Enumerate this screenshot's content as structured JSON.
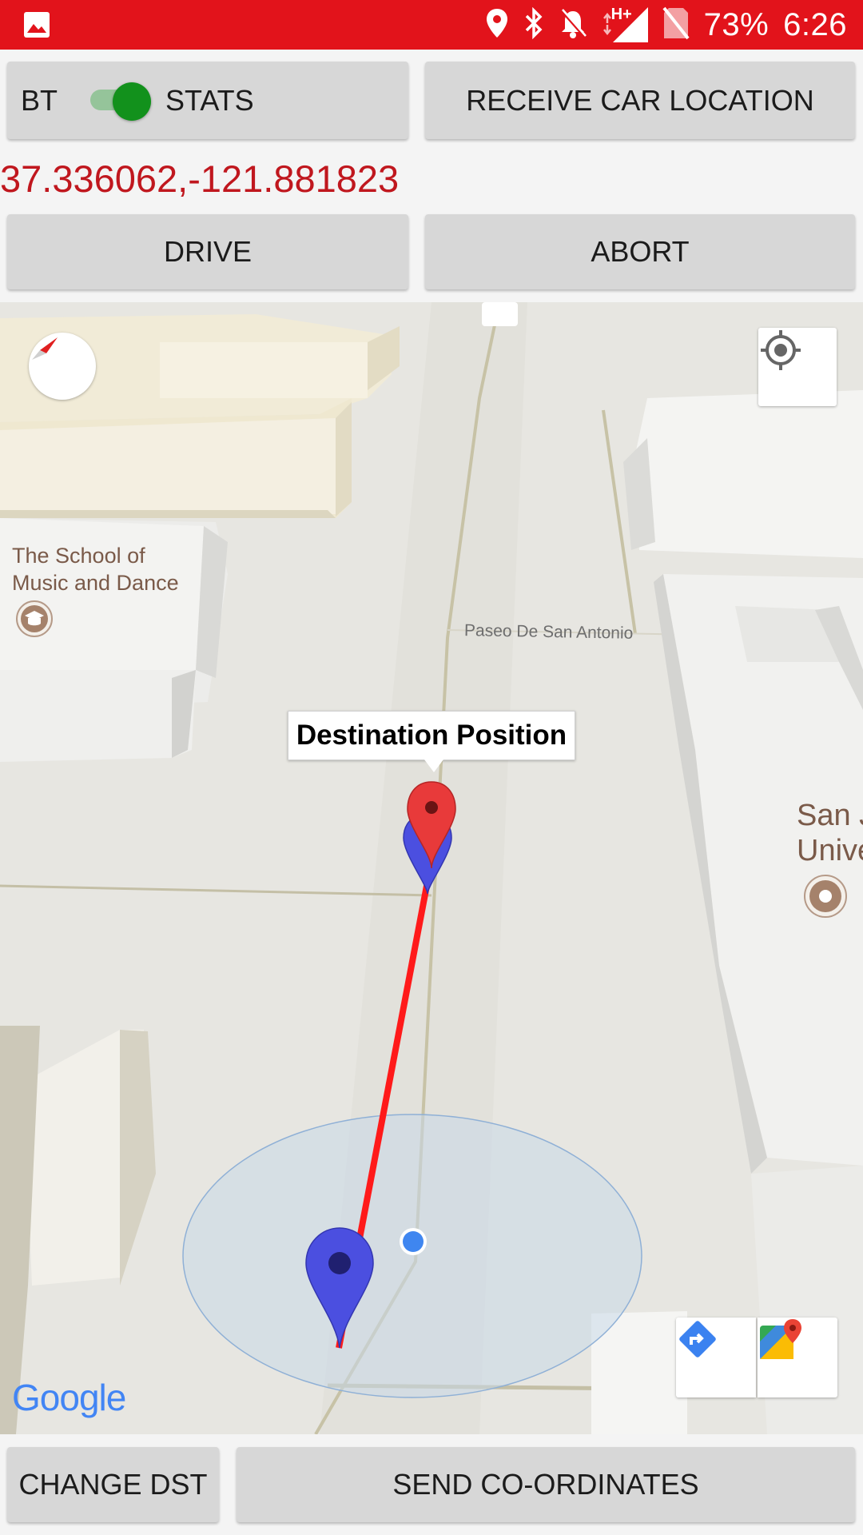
{
  "status_bar": {
    "battery": "73%",
    "time": "6:26",
    "network": "H+",
    "icons": [
      "image-icon",
      "location-icon",
      "bluetooth-icon",
      "notifications-off-icon",
      "signal-icon",
      "no-sim-icon"
    ]
  },
  "toggle": {
    "left_label": "BT",
    "right_label": "STATS",
    "state": "on"
  },
  "buttons": {
    "receive": "RECEIVE CAR LOCATION",
    "drive": "DRIVE",
    "abort": "ABORT",
    "change_dst": "CHANGE DST",
    "send": "SEND CO-ORDINATES"
  },
  "coordinates": "37.336062,-121.881823",
  "map": {
    "labels": {
      "school_line1": "The School of",
      "school_line2": "Music and Dance",
      "street": "Paseo De San Antonio",
      "univ_line1": "San J",
      "univ_line2": "Unive"
    },
    "info_window": "Destination Position",
    "attribution": "Google"
  },
  "colors": {
    "status_bar": "#e2131b",
    "accent_red": "#c0171e",
    "toggle_on": "#12911c",
    "route": "#ff1a1a",
    "marker_blue": "#4b4fe0",
    "marker_red": "#e83a3a"
  }
}
